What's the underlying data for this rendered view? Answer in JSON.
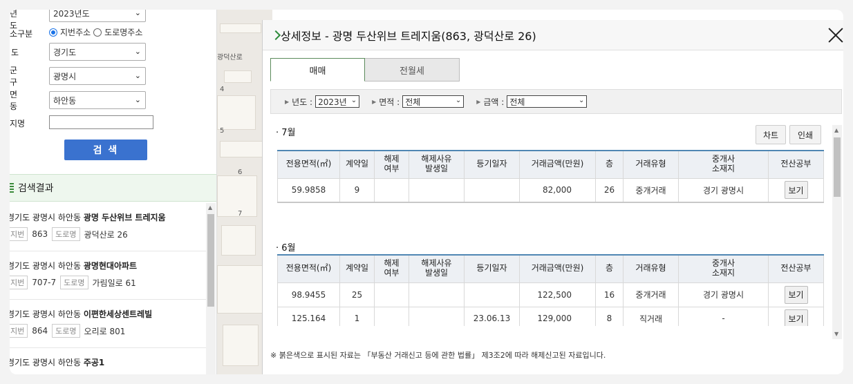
{
  "left_panel": {
    "year_label": "준년도",
    "year_value": "2023년도",
    "addr_type_label": "소구분",
    "addr_type_options": [
      "지번주소",
      "도로명주소"
    ],
    "sido_label": "도",
    "sido_value": "경기도",
    "sigungu_label": "군구",
    "sigungu_value": "광명시",
    "dong_label": "면동",
    "dong_value": "하안동",
    "complex_label": "지명",
    "search_button": "검 색",
    "results_title": "검색결과",
    "results": [
      {
        "addr_prefix": "경기도 광명시 하안동 ",
        "name": "광명 두산위브 트레지움",
        "jibun_tag": "지번",
        "jibun": "863",
        "road_tag": "도로명",
        "road": "광덕산로 26"
      },
      {
        "addr_prefix": "경기도 광명시 하안동 ",
        "name": "광명현대아파트",
        "jibun_tag": "지번",
        "jibun": "707-7",
        "road_tag": "도로명",
        "road": "가림일로 61"
      },
      {
        "addr_prefix": "경기도 광명시 하안동 ",
        "name": "이편한세상센트레빌",
        "jibun_tag": "지번",
        "jibun": "864",
        "road_tag": "도로명",
        "road": "오리로 801"
      },
      {
        "addr_prefix": "경기도 광명시 하안동 ",
        "name": "주공1",
        "jibun_tag": "",
        "jibun": "",
        "road_tag": "",
        "road": ""
      }
    ]
  },
  "map": {
    "road_label": "광덕산로",
    "numbers": [
      "4",
      "5",
      "6",
      "7"
    ]
  },
  "modal": {
    "title": "상세정보 - 광명 두산위브 트레지움(863, 광덕산로 26)",
    "tabs": [
      "매매",
      "전월세"
    ],
    "filters": {
      "year_label": "년도 :",
      "year_value": "2023년",
      "area_label": "면적 :",
      "area_value": "전체",
      "price_label": "금액 :",
      "price_value": "전체"
    },
    "chart_button": "차트",
    "print_button": "인쇄",
    "headers": [
      "전용면적(㎡)",
      "계약일",
      "해제\n여부",
      "해제사유\n발생일",
      "등기일자",
      "거래금액(만원)",
      "층",
      "거래유형",
      "중개사\n소재지",
      "전산공부"
    ],
    "view_label": "보기",
    "months": [
      {
        "label": "· 7월",
        "rows": [
          {
            "area": "59.9858",
            "day": "9",
            "cancel": "",
            "cancel_date": "",
            "reg_date": "",
            "price": "82,000",
            "floor": "26",
            "type": "중개거래",
            "agent": "경기 광명시"
          }
        ]
      },
      {
        "label": "· 6월",
        "rows": [
          {
            "area": "98.9455",
            "day": "25",
            "cancel": "",
            "cancel_date": "",
            "reg_date": "",
            "price": "122,500",
            "floor": "16",
            "type": "중개거래",
            "agent": "경기 광명시"
          },
          {
            "area": "125.164",
            "day": "1",
            "cancel": "",
            "cancel_date": "",
            "reg_date": "23.06.13",
            "price": "129,000",
            "floor": "8",
            "type": "직거래",
            "agent": "-"
          }
        ]
      }
    ],
    "note": "※ 붉은색으로 표시된 자료는 「부동산 거래신고 등에 관한 법률」 제3조2에 따라 해제신고된 자료입니다."
  }
}
